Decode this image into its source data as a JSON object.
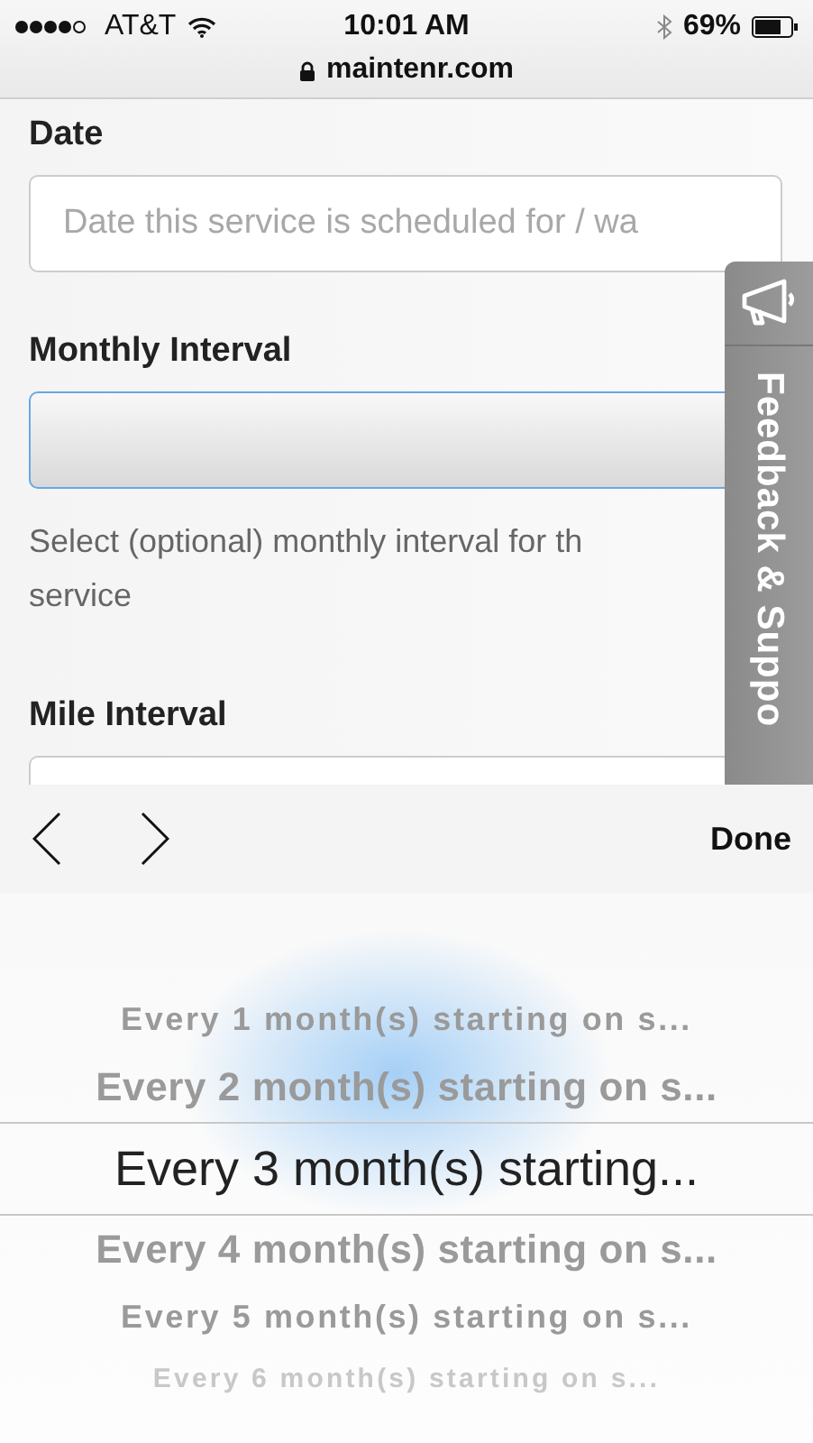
{
  "status_bar": {
    "carrier": "AT&T",
    "time": "10:01 AM",
    "battery": "69%"
  },
  "address_bar": {
    "url": "maintenr.com"
  },
  "form": [
    {
      "kind": "text",
      "label": "Date",
      "placeholder": "Date this service is scheduled for / wa"
    },
    {
      "kind": "select",
      "label": "Monthly Interval",
      "focused": true,
      "help": [
        "Select (optional) monthly interval for th",
        "service"
      ]
    },
    {
      "kind": "text",
      "label": "Mile Interval"
    }
  ],
  "feedback_tab": {
    "label": "Feedback & Suppo"
  },
  "keyboard_toolbar": {
    "done": "Done"
  },
  "picker": [
    {
      "text": "Every 1 month(s) starting on s...",
      "selected": false
    },
    {
      "text": "Every 2 month(s) starting on s...",
      "selected": false
    },
    {
      "text": "Every 3 month(s) starting...",
      "selected": true
    },
    {
      "text": "Every 4 month(s) starting on s...",
      "selected": false
    },
    {
      "text": "Every 5 month(s) starting on s...",
      "selected": false
    },
    {
      "text": "Every 6 month(s) starting on s...",
      "selected": false
    }
  ]
}
